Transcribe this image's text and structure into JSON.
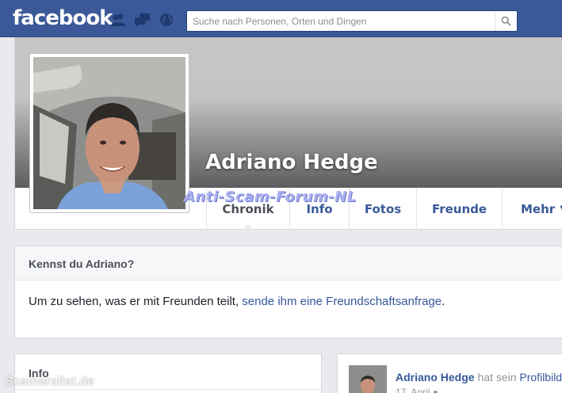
{
  "header": {
    "logo": "facebook",
    "search": {
      "placeholder": "Suche nach Personen, Orten und Dingen"
    },
    "jewels": [
      "friend-requests-icon",
      "messages-icon",
      "notifications-globe-icon"
    ],
    "search_icon": "search-icon",
    "colors": {
      "bar": "#3b5998",
      "text": "#ffffff"
    }
  },
  "profile": {
    "name": "Adriano Hedge",
    "tabs": [
      {
        "label": "Chronik",
        "active": true
      },
      {
        "label": "Info"
      },
      {
        "label": "Fotos"
      },
      {
        "label": "Freunde"
      },
      {
        "label": "Mehr",
        "dropdown": true
      }
    ]
  },
  "watermarks": {
    "forum": "Anti-Scam-Forum-NL",
    "site": "Scamerslist.de"
  },
  "know_box": {
    "title": "Kennst du Adriano?",
    "text": "Um zu sehen, was er mit Freunden teilt,",
    "link": "sende ihm eine Freundschaftsanfrage",
    "suffix": "."
  },
  "info_box": {
    "title": "Info"
  },
  "post": {
    "author": "Adriano Hedge",
    "action": "hat sein",
    "object": "Profilbild",
    "date": "17. April"
  }
}
